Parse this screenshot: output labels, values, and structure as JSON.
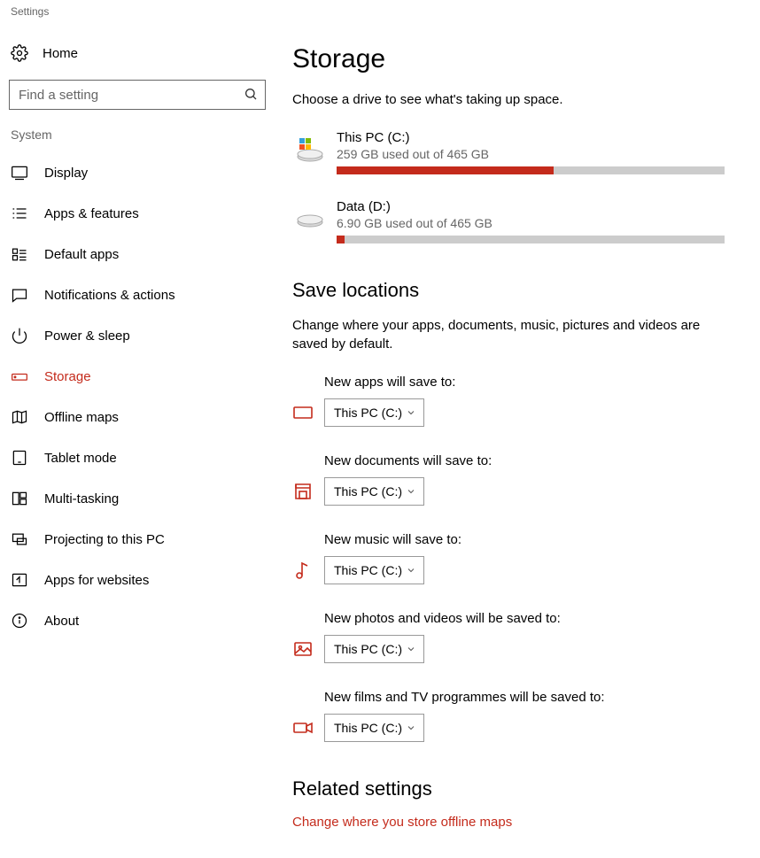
{
  "window_title": "Settings",
  "home_label": "Home",
  "search": {
    "placeholder": "Find a setting"
  },
  "nav_section": "System",
  "nav": {
    "display": "Display",
    "apps_features": "Apps & features",
    "default_apps": "Default apps",
    "notifications": "Notifications & actions",
    "power_sleep": "Power & sleep",
    "storage": "Storage",
    "offline_maps": "Offline maps",
    "tablet_mode": "Tablet mode",
    "multi_tasking": "Multi-tasking",
    "projecting": "Projecting to this PC",
    "apps_websites": "Apps for websites",
    "about": "About"
  },
  "storage": {
    "heading": "Storage",
    "subtext": "Choose a drive to see what's taking up space.",
    "drives": [
      {
        "name": "This PC (C:)",
        "used_text": "259 GB used out of 465 GB",
        "fill_pct": 56
      },
      {
        "name": "Data (D:)",
        "used_text": "6.90 GB used out of 465 GB",
        "fill_pct": 2
      }
    ]
  },
  "save_locations": {
    "heading": "Save locations",
    "subtext": "Change where your apps, documents, music, pictures and videos are saved by default.",
    "default_drive": "This PC (C:)",
    "rows": {
      "apps": "New apps will save to:",
      "docs": "New documents will save to:",
      "music": "New music will save to:",
      "photos": "New photos and videos will be saved to:",
      "films": "New films and TV programmes will be saved to:"
    }
  },
  "related": {
    "heading": "Related settings",
    "link": "Change where you store offline maps"
  }
}
